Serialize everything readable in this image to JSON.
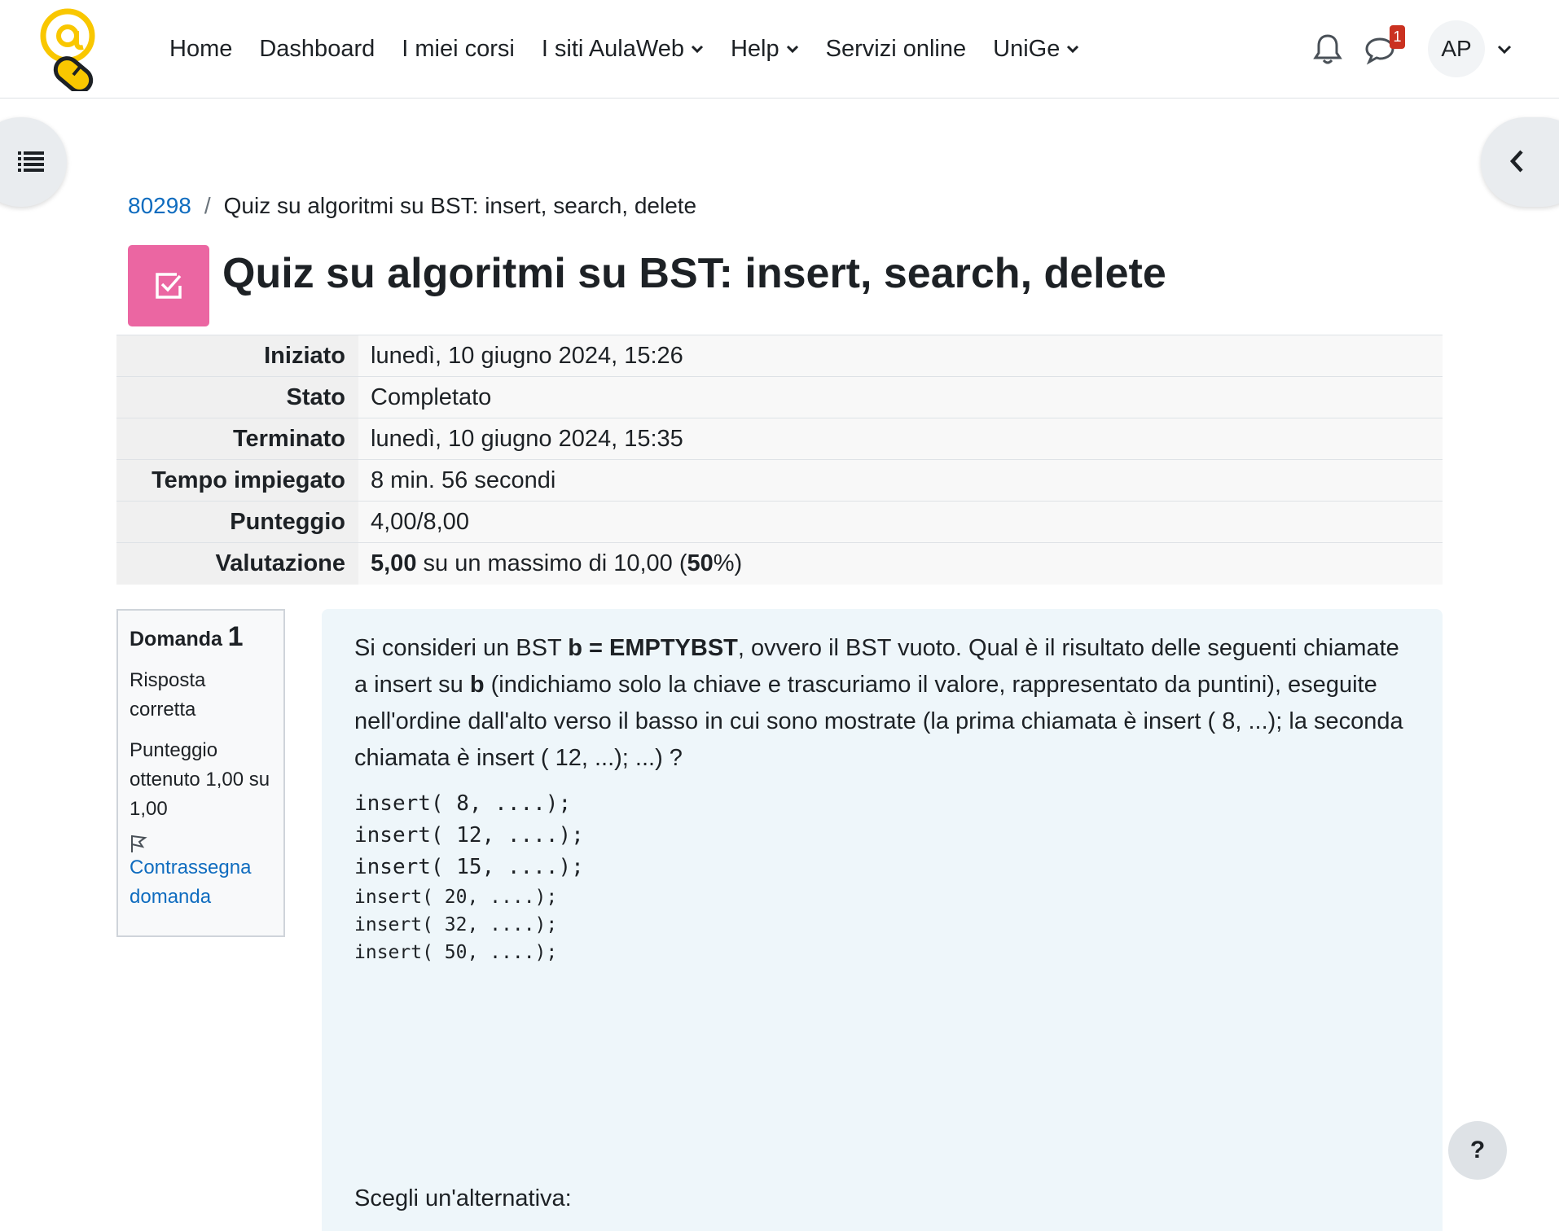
{
  "nav": {
    "items": [
      {
        "label": "Home",
        "dropdown": false
      },
      {
        "label": "Dashboard",
        "dropdown": false
      },
      {
        "label": "I miei corsi",
        "dropdown": false
      },
      {
        "label": "I siti AulaWeb",
        "dropdown": true
      },
      {
        "label": "Help",
        "dropdown": true
      },
      {
        "label": "Servizi online",
        "dropdown": false
      },
      {
        "label": "UniGe",
        "dropdown": true
      }
    ],
    "message_badge": "1",
    "avatar_initials": "AP"
  },
  "breadcrumb": {
    "course": "80298",
    "separator": "/",
    "current": "Quiz su algoritmi su BST: insert, search, delete"
  },
  "page_title": "Quiz su algoritmi su BST: insert, search, delete",
  "summary": {
    "rows": [
      {
        "label": "Iniziato",
        "value": "lunedì, 10 giugno 2024, 15:26"
      },
      {
        "label": "Stato",
        "value": "Completato"
      },
      {
        "label": "Terminato",
        "value": "lunedì, 10 giugno 2024, 15:35"
      },
      {
        "label": "Tempo impiegato",
        "value": "8 min. 56 secondi"
      },
      {
        "label": "Punteggio",
        "value": "4,00/8,00"
      }
    ],
    "grade": {
      "label": "Valutazione",
      "score": "5,00",
      "middle": " su un massimo di 10,00 (",
      "percent": "50",
      "end": "%)"
    }
  },
  "question_info": {
    "label": "Domanda",
    "number": "1",
    "state": "Risposta corretta",
    "grade": "Punteggio ottenuto 1,00 su 1,00",
    "flag_label": "Contrassegna domanda"
  },
  "question": {
    "text_1": "Si consideri un BST ",
    "bold_1": "b = EMPTYBST",
    "text_2": ", ovvero il BST vuoto. Qual è il risultato delle seguenti chiamate a insert su ",
    "bold_2": "b",
    "text_3": " (indichiamo solo la chiave e trascuriamo il valore, rappresentato da puntini), eseguite nell'ordine dall'alto verso il basso in cui sono mostrate (la prima chiamata è insert ( 8, ...); la seconda chiamata è insert ( 12, ...); ...) ?",
    "code_big": [
      "insert( 8, ....);",
      "insert( 12, ....);",
      "insert( 15, ....);"
    ],
    "code_small": [
      "insert( 20, ....);",
      "insert( 32, ....);",
      "insert( 50, ....);"
    ],
    "choose_label": "Scegli un'alternativa:"
  },
  "help_label": "?",
  "colors": {
    "link": "#0f6cbf",
    "quiz_icon": "#eb66a2",
    "badge": "#ca3120",
    "question_bg": "#eef6fa"
  }
}
